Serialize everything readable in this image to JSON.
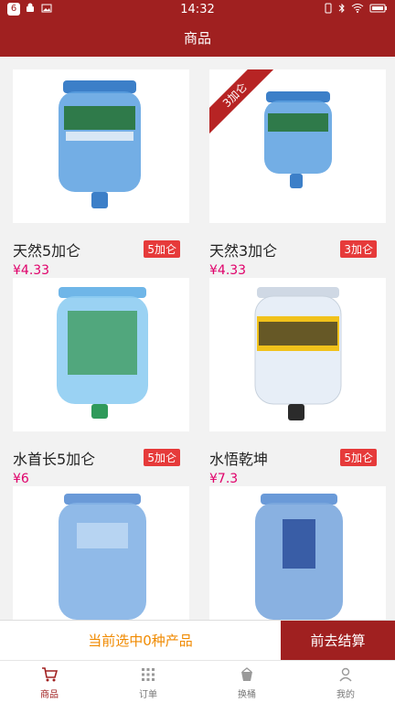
{
  "status_bar": {
    "time": "14:32",
    "badge": "6",
    "left_icons": [
      "android-icon",
      "image-icon"
    ],
    "right_icons": [
      "vibrate-icon",
      "bluetooth-icon",
      "wifi-icon",
      "battery-icon"
    ]
  },
  "header": {
    "title": "商品"
  },
  "products": [
    {
      "name": "天然5加仑",
      "tag": "5加仑",
      "price": "¥4.33",
      "ribbon": ""
    },
    {
      "name": "天然3加仑",
      "tag": "3加仑",
      "price": "¥4.33",
      "ribbon": "3加仑"
    },
    {
      "name": "水首长5加仑",
      "tag": "5加仑",
      "price": "¥6",
      "ribbon": ""
    },
    {
      "name": "水悟乾坤",
      "tag": "5加仑",
      "price": "¥7.3",
      "ribbon": ""
    },
    {
      "name": "",
      "tag": "",
      "price": "",
      "ribbon": ""
    },
    {
      "name": "",
      "tag": "",
      "price": "",
      "ribbon": ""
    }
  ],
  "cart": {
    "summary": "当前选中0种产品",
    "checkout": "前去结算"
  },
  "tabs": [
    {
      "label": "商品",
      "icon": "cart-icon",
      "active": true
    },
    {
      "label": "订单",
      "icon": "grid-icon",
      "active": false
    },
    {
      "label": "换桶",
      "icon": "bucket-icon",
      "active": false
    },
    {
      "label": "我的",
      "icon": "user-icon",
      "active": false
    }
  ],
  "colors": {
    "brand": "#a02020",
    "price": "#e0006a",
    "tag": "#e63a3a",
    "summary": "#f08a00"
  }
}
